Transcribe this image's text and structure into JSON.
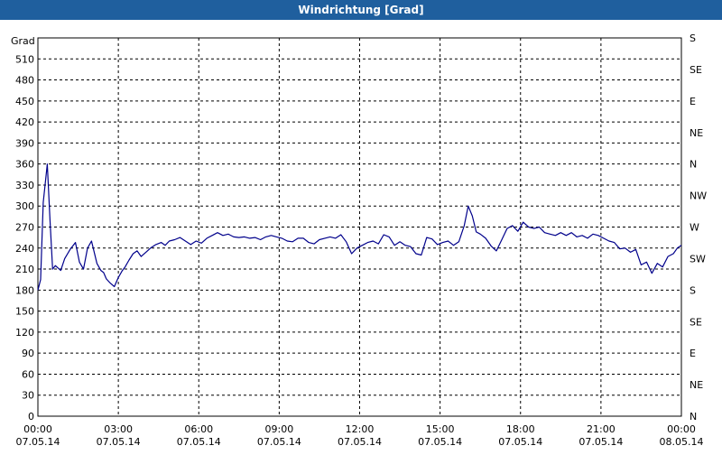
{
  "window": {
    "title": "Windrichtung [Grad]"
  },
  "chart_data": {
    "type": "line",
    "title": "Windrichtung [Grad]",
    "ylabel": "Grad",
    "ylim": [
      0,
      540
    ],
    "yticks": [
      0,
      30,
      60,
      90,
      120,
      150,
      180,
      210,
      240,
      270,
      300,
      330,
      360,
      390,
      420,
      450,
      480,
      510
    ],
    "right_axis_labels": [
      {
        "value": 0,
        "label": "N"
      },
      {
        "value": 45,
        "label": "NE"
      },
      {
        "value": 90,
        "label": "E"
      },
      {
        "value": 135,
        "label": "SE"
      },
      {
        "value": 180,
        "label": "S"
      },
      {
        "value": 225,
        "label": "SW"
      },
      {
        "value": 270,
        "label": "W"
      },
      {
        "value": 315,
        "label": "NW"
      },
      {
        "value": 360,
        "label": "N"
      },
      {
        "value": 405,
        "label": "NE"
      },
      {
        "value": 450,
        "label": "E"
      },
      {
        "value": 495,
        "label": "SE"
      },
      {
        "value": 540,
        "label": "S"
      }
    ],
    "xlim_hours": [
      0,
      24
    ],
    "xticks": [
      {
        "h": 0,
        "time": "00:00",
        "date": "07.05.14"
      },
      {
        "h": 3,
        "time": "03:00",
        "date": "07.05.14"
      },
      {
        "h": 6,
        "time": "06:00",
        "date": "07.05.14"
      },
      {
        "h": 9,
        "time": "09:00",
        "date": "07.05.14"
      },
      {
        "h": 12,
        "time": "12:00",
        "date": "07.05.14"
      },
      {
        "h": 15,
        "time": "15:00",
        "date": "07.05.14"
      },
      {
        "h": 18,
        "time": "18:00",
        "date": "07.05.14"
      },
      {
        "h": 21,
        "time": "21:00",
        "date": "07.05.14"
      },
      {
        "h": 24,
        "time": "00:00",
        "date": "08.05.14"
      }
    ],
    "grid": true,
    "line_color": "#00008b",
    "series": [
      {
        "x": [
          0.0,
          0.1,
          0.2,
          0.35,
          0.45,
          0.55,
          0.65,
          0.85,
          1.0,
          1.2,
          1.4,
          1.55,
          1.7,
          1.85,
          2.0,
          2.2,
          2.35,
          2.45,
          2.55,
          2.7,
          2.85,
          3.0,
          3.15,
          3.25,
          3.4,
          3.55,
          3.7,
          3.85,
          4.0,
          4.2,
          4.4,
          4.6,
          4.75,
          4.9,
          5.1,
          5.3,
          5.5,
          5.7,
          5.9,
          6.1,
          6.3,
          6.5,
          6.7,
          6.9,
          7.1,
          7.3,
          7.5,
          7.7,
          7.9,
          8.1,
          8.3,
          8.5,
          8.7,
          8.9,
          9.1,
          9.3,
          9.5,
          9.7,
          9.9,
          10.1,
          10.3,
          10.5,
          10.7,
          10.9,
          11.1,
          11.3,
          11.5,
          11.7,
          11.9,
          12.1,
          12.3,
          12.5,
          12.7,
          12.9,
          13.1,
          13.3,
          13.5,
          13.7,
          13.9,
          14.1,
          14.3,
          14.5,
          14.7,
          14.9,
          15.1,
          15.3,
          15.5,
          15.7,
          15.9,
          16.05,
          16.2,
          16.35,
          16.5,
          16.7,
          16.9,
          17.1,
          17.3,
          17.5,
          17.7,
          17.9,
          18.1,
          18.3,
          18.5,
          18.7,
          18.9,
          19.1,
          19.3,
          19.5,
          19.7,
          19.9,
          20.1,
          20.3,
          20.5,
          20.7,
          20.9,
          21.1,
          21.3,
          21.5,
          21.7,
          21.9,
          22.1,
          22.3,
          22.5,
          22.7,
          22.9,
          23.1,
          23.3,
          23.5,
          23.7,
          23.85,
          24.0
        ],
        "y": [
          180,
          195,
          305,
          360,
          280,
          210,
          215,
          208,
          225,
          238,
          248,
          220,
          210,
          240,
          250,
          218,
          208,
          205,
          196,
          190,
          185,
          198,
          208,
          213,
          223,
          232,
          236,
          228,
          233,
          240,
          245,
          248,
          244,
          250,
          252,
          255,
          250,
          245,
          250,
          247,
          254,
          258,
          262,
          258,
          260,
          256,
          255,
          256,
          254,
          255,
          252,
          256,
          258,
          256,
          254,
          250,
          249,
          254,
          254,
          248,
          246,
          252,
          254,
          256,
          254,
          259,
          249,
          232,
          240,
          244,
          248,
          250,
          246,
          259,
          256,
          244,
          249,
          244,
          242,
          232,
          230,
          255,
          253,
          245,
          248,
          250,
          244,
          249,
          272,
          300,
          286,
          263,
          260,
          254,
          243,
          236,
          252,
          268,
          272,
          264,
          277,
          270,
          268,
          270,
          262,
          260,
          258,
          262,
          258,
          262,
          256,
          258,
          254,
          260,
          258,
          254,
          250,
          248,
          239,
          240,
          234,
          238,
          216,
          220,
          204,
          218,
          213,
          228,
          232,
          240,
          244
        ]
      }
    ]
  }
}
